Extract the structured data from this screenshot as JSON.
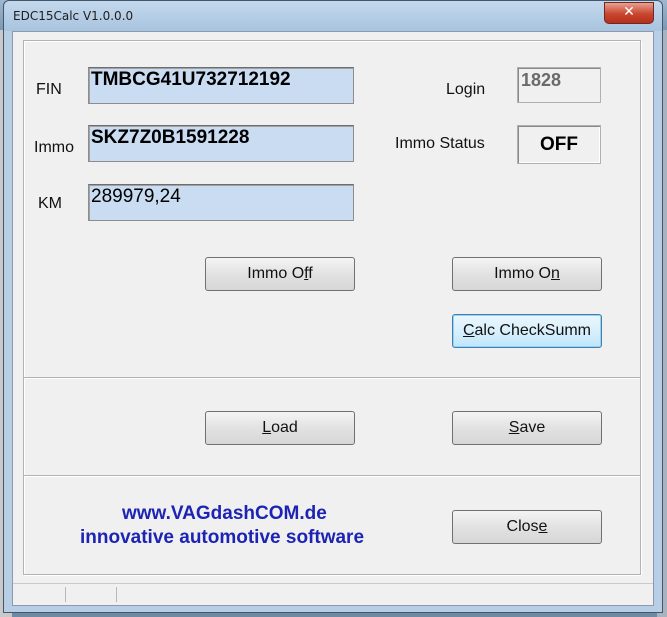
{
  "window": {
    "title": "EDC15Calc V1.0.0.0",
    "close_glyph": "✕"
  },
  "fields": {
    "fin": {
      "label": "FIN",
      "value": "TMBCG41U732712192"
    },
    "immo": {
      "label": "Immo",
      "value": "SKZ7Z0B1591228"
    },
    "km": {
      "label": "KM",
      "value": "289979,24"
    }
  },
  "login": {
    "label": "Login",
    "value": "1828"
  },
  "immo_status": {
    "label": "Immo Status",
    "value": "OFF"
  },
  "buttons": {
    "immo_off": {
      "pre": "Immo O",
      "mn": "f",
      "post": "f"
    },
    "immo_on": {
      "pre": "Immo O",
      "mn": "n",
      "post": ""
    },
    "calc": {
      "pre": "",
      "mn": "C",
      "post": "alc CheckSumm"
    },
    "load": {
      "pre": "",
      "mn": "L",
      "post": "oad"
    },
    "save": {
      "pre": "",
      "mn": "S",
      "post": "ave"
    },
    "close": {
      "pre": "Clos",
      "mn": "e",
      "post": ""
    }
  },
  "brand": {
    "line1": "www.VAGdashCOM.de",
    "line2": "innovative automotive software"
  }
}
